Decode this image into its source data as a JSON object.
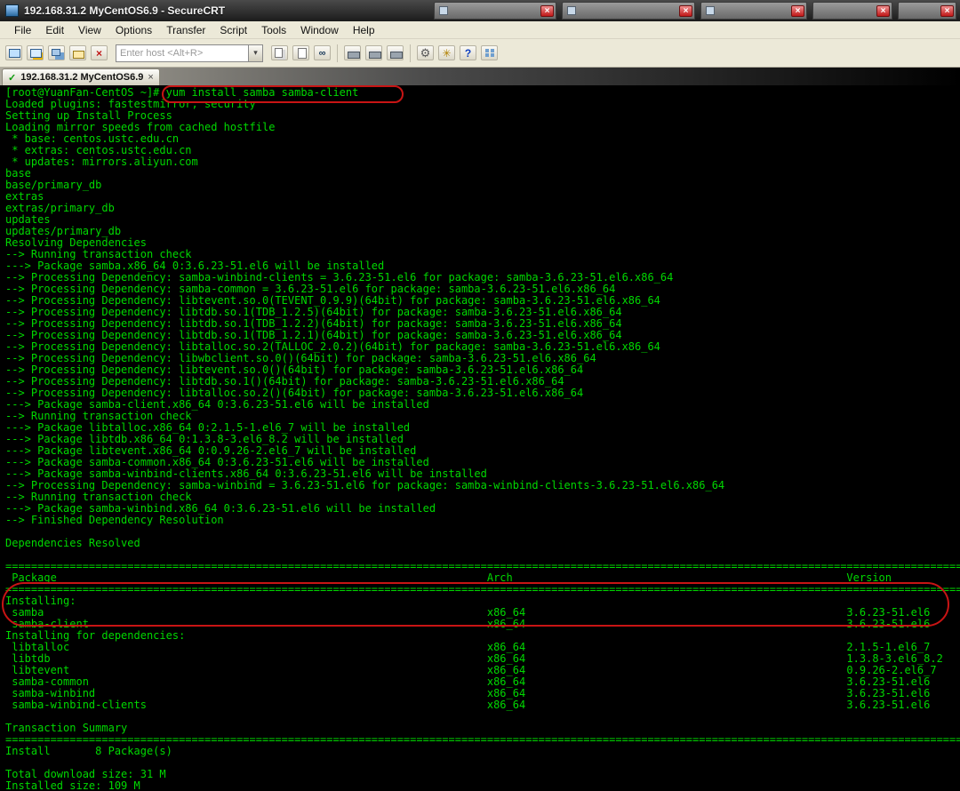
{
  "titlebar": {
    "title": "192.168.31.2 MyCentOS6.9 - SecureCRT"
  },
  "menubar": {
    "items": [
      "File",
      "Edit",
      "View",
      "Options",
      "Transfer",
      "Script",
      "Tools",
      "Window",
      "Help"
    ]
  },
  "toolbar": {
    "host_placeholder": "Enter host <Alt+R>",
    "icons": [
      "connect-icon",
      "quick-connect-icon",
      "connect-in-tab-icon",
      "session-manager-icon",
      "disconnect-icon",
      "copy-icon",
      "paste-icon",
      "find-icon",
      "print-icon",
      "print-preview-icon",
      "page-setup-icon",
      "clear-screen-icon",
      "options-gear-icon",
      "help-icon",
      "tile-windows-icon"
    ]
  },
  "session_tab": {
    "label": "192.168.31.2 MyCentOS6.9"
  },
  "glyphs": {
    "close": "×",
    "check": "✓",
    "dropdown": "▾",
    "gear": "⚙",
    "help": "?",
    "find": "∞",
    "clear": "✳"
  },
  "colors": {
    "terminal_text": "#00d800",
    "terminal_bg": "#000000",
    "annotation": "#c81414",
    "chrome": "#ece9d8"
  },
  "terminal": {
    "columns": [
      1,
      75,
      131
    ],
    "lines": [
      "[root@YuanFan-CentOS ~]# yum install samba samba-client",
      "Loaded plugins: fastestmirror, security",
      "Setting up Install Process",
      "Loading mirror speeds from cached hostfile",
      " * base: centos.ustc.edu.cn",
      " * extras: centos.ustc.edu.cn",
      " * updates: mirrors.aliyun.com",
      "base",
      "base/primary_db",
      "extras",
      "extras/primary_db",
      "updates",
      "updates/primary_db",
      "Resolving Dependencies",
      "--> Running transaction check",
      "---> Package samba.x86_64 0:3.6.23-51.el6 will be installed",
      "--> Processing Dependency: samba-winbind-clients = 3.6.23-51.el6 for package: samba-3.6.23-51.el6.x86_64",
      "--> Processing Dependency: samba-common = 3.6.23-51.el6 for package: samba-3.6.23-51.el6.x86_64",
      "--> Processing Dependency: libtevent.so.0(TEVENT_0.9.9)(64bit) for package: samba-3.6.23-51.el6.x86_64",
      "--> Processing Dependency: libtdb.so.1(TDB_1.2.5)(64bit) for package: samba-3.6.23-51.el6.x86_64",
      "--> Processing Dependency: libtdb.so.1(TDB_1.2.2)(64bit) for package: samba-3.6.23-51.el6.x86_64",
      "--> Processing Dependency: libtdb.so.1(TDB_1.2.1)(64bit) for package: samba-3.6.23-51.el6.x86_64",
      "--> Processing Dependency: libtalloc.so.2(TALLOC_2.0.2)(64bit) for package: samba-3.6.23-51.el6.x86_64",
      "--> Processing Dependency: libwbclient.so.0()(64bit) for package: samba-3.6.23-51.el6.x86_64",
      "--> Processing Dependency: libtevent.so.0()(64bit) for package: samba-3.6.23-51.el6.x86_64",
      "--> Processing Dependency: libtdb.so.1()(64bit) for package: samba-3.6.23-51.el6.x86_64",
      "--> Processing Dependency: libtalloc.so.2()(64bit) for package: samba-3.6.23-51.el6.x86_64",
      "---> Package samba-client.x86_64 0:3.6.23-51.el6 will be installed",
      "--> Running transaction check",
      "---> Package libtalloc.x86_64 0:2.1.5-1.el6_7 will be installed",
      "---> Package libtdb.x86_64 0:1.3.8-3.el6_8.2 will be installed",
      "---> Package libtevent.x86_64 0:0.9.26-2.el6_7 will be installed",
      "---> Package samba-common.x86_64 0:3.6.23-51.el6 will be installed",
      "---> Package samba-winbind-clients.x86_64 0:3.6.23-51.el6 will be installed",
      "--> Processing Dependency: samba-winbind = 3.6.23-51.el6 for package: samba-winbind-clients-3.6.23-51.el6.x86_64",
      "--> Running transaction check",
      "---> Package samba-winbind.x86_64 0:3.6.23-51.el6 will be installed",
      "--> Finished Dependency Resolution",
      "",
      "Dependencies Resolved",
      "",
      {
        "f": "="
      },
      {
        "c": [
          "Package",
          "Arch",
          "Version"
        ]
      },
      {
        "f": "="
      },
      "Installing:",
      {
        "c": [
          "samba",
          "x86_64",
          "3.6.23-51.el6"
        ]
      },
      {
        "c": [
          "samba-client",
          "x86_64",
          "3.6.23-51.el6"
        ]
      },
      "Installing for dependencies:",
      {
        "c": [
          "libtalloc",
          "x86_64",
          "2.1.5-1.el6_7"
        ]
      },
      {
        "c": [
          "libtdb",
          "x86_64",
          "1.3.8-3.el6_8.2"
        ]
      },
      {
        "c": [
          "libtevent",
          "x86_64",
          "0.9.26-2.el6_7"
        ]
      },
      {
        "c": [
          "samba-common",
          "x86_64",
          "3.6.23-51.el6"
        ]
      },
      {
        "c": [
          "samba-winbind",
          "x86_64",
          "3.6.23-51.el6"
        ]
      },
      {
        "c": [
          "samba-winbind-clients",
          "x86_64",
          "3.6.23-51.el6"
        ]
      },
      "",
      "Transaction Summary",
      {
        "f": "="
      },
      "Install       8 Package(s)",
      "",
      "Total download size: 31 M",
      "Installed size: 109 M"
    ]
  }
}
